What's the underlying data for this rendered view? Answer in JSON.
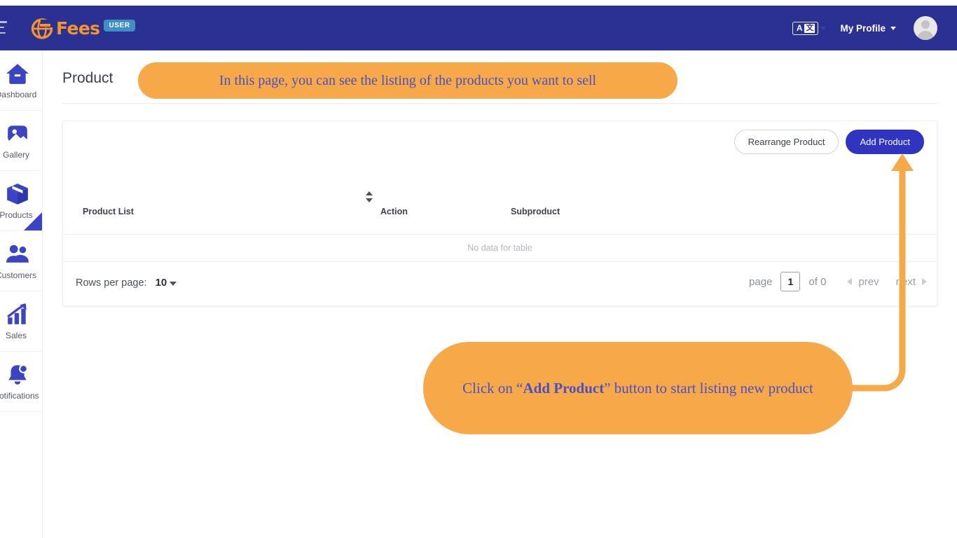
{
  "topbar": {
    "menu_icon": "hamburger-menu-icon",
    "brand_name": "Fees",
    "brand_badge": "USER",
    "language_icon_a": "A",
    "language_icon_z": "文",
    "profile_label": "My Profile",
    "bg_color": "#2b3093",
    "brand_color": "#f2952e",
    "badge_color": "#3e8fc4"
  },
  "sidebar": {
    "items": [
      {
        "label": "Dashboard",
        "icon": "home-icon",
        "active": false
      },
      {
        "label": "Gallery",
        "icon": "image-icon",
        "active": false
      },
      {
        "label": "Products",
        "icon": "box-icon",
        "active": true
      },
      {
        "label": "Customers",
        "icon": "users-icon",
        "active": false
      },
      {
        "label": "Sales",
        "icon": "chart-up-icon",
        "active": false
      },
      {
        "label": "Notifications",
        "icon": "bell-icon",
        "active": false
      }
    ],
    "active_color": "#3b45c4"
  },
  "main": {
    "page_title": "Product",
    "buttons": {
      "rearrange": "Rearrange Product",
      "add": "Add Product",
      "add_color": "#2f35c1"
    },
    "table": {
      "sort_icon": "sort-updown-icon",
      "columns": [
        "Product List",
        "Action",
        "Subproduct"
      ],
      "rows": [],
      "empty_text": "No data for table"
    },
    "pagination": {
      "rows_per_page_label": "Rows per page:",
      "rows_per_page_value": "10",
      "page_word": "page",
      "page_value": "1",
      "of_label": "of 0",
      "prev_label": "prev",
      "next_label": "next"
    }
  },
  "annotations": {
    "color": "#f7a94a",
    "text_color": "#4a50c4",
    "top_callout": "In this page, you can see the listing of the products you want to sell",
    "bottom_callout_part1": "Click on “",
    "bottom_callout_bold": "Add Product",
    "bottom_callout_part2": "” button to start listing new product",
    "arrow": "curved-up-arrow"
  }
}
